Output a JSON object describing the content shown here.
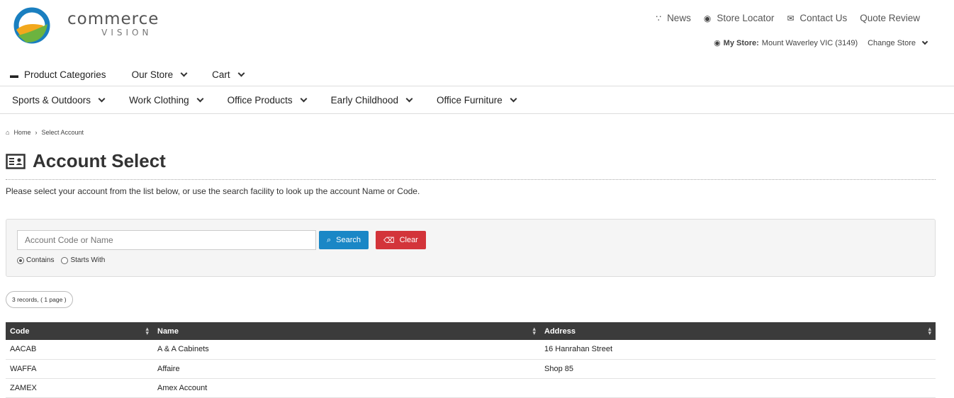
{
  "brand": {
    "name": "commerce",
    "sub": "VISION"
  },
  "top_links": [
    {
      "icon": "rss-icon",
      "label": "News"
    },
    {
      "icon": "map-pin-icon",
      "label": "Store Locator"
    },
    {
      "icon": "envelope-icon",
      "label": "Contact Us"
    },
    {
      "icon": "",
      "label": "Quote Review"
    }
  ],
  "store": {
    "label": "My Store:",
    "value": "Mount Waverley VIC (3149)",
    "change": "Change Store"
  },
  "nav_primary": [
    {
      "label": "Product Categories",
      "icon": "box-icon"
    },
    {
      "label": "Our Store",
      "dropdown": true
    },
    {
      "label": "Cart",
      "dropdown": true
    }
  ],
  "nav_categories": [
    {
      "label": "Sports & Outdoors"
    },
    {
      "label": "Work Clothing"
    },
    {
      "label": "Office Products"
    },
    {
      "label": "Early Childhood"
    },
    {
      "label": "Office Furniture"
    }
  ],
  "breadcrumb": {
    "home": "Home",
    "current": "Select Account"
  },
  "page": {
    "title": "Account Select",
    "intro": "Please select your account from the list below, or use the search facility to look up the account Name or Code."
  },
  "search": {
    "placeholder": "Account Code or Name",
    "search_label": "Search",
    "clear_label": "Clear",
    "options": [
      {
        "label": "Contains",
        "selected": true
      },
      {
        "label": "Starts With",
        "selected": false
      }
    ]
  },
  "records_summary": "3 records, ( 1 page )",
  "table": {
    "columns": [
      "Code",
      "Name",
      "Address"
    ],
    "rows": [
      [
        "AACAB",
        "A & A Cabinets",
        "16 Hanrahan Street"
      ],
      [
        "WAFFA",
        "Affaire",
        "Shop 85"
      ],
      [
        "ZAMEX",
        "Amex Account",
        ""
      ]
    ]
  },
  "colors": {
    "header_bg": "#3b3b3b",
    "search_btn": "#1a87c6",
    "clear_btn": "#d3343a"
  }
}
